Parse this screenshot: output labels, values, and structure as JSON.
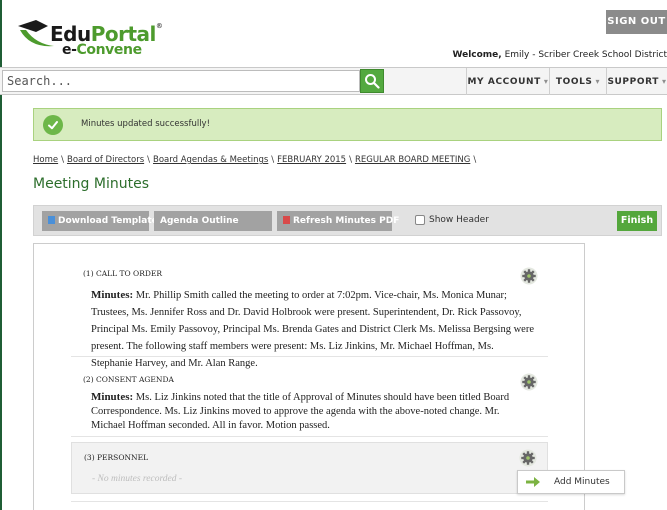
{
  "brand": {
    "name_part1": "Edu",
    "name_part2": "Portal",
    "tm": "®",
    "sub_part1": "e-",
    "sub_part2": "Convene"
  },
  "header": {
    "signout_label": "SIGN OUT",
    "welcome_prefix": "Welcome,",
    "welcome_user": "Emily - Scriber Creek School District"
  },
  "search": {
    "placeholder": "Search..."
  },
  "nav": {
    "items": [
      {
        "label": "MY ACCOUNT",
        "caret": "▾"
      },
      {
        "label": "TOOLS",
        "caret": "▾"
      },
      {
        "label": "SUPPORT",
        "caret": "▾"
      }
    ]
  },
  "alert": {
    "message": "Minutes updated successfully!"
  },
  "breadcrumb": {
    "items": [
      "Home",
      "Board of Directors",
      "Board Agendas & Meetings",
      "FEBRUARY 2015",
      "REGULAR BOARD MEETING"
    ],
    "separator": "\\"
  },
  "page": {
    "title": "Meeting Minutes"
  },
  "toolbar": {
    "download_label": "Download Template",
    "outline_label": "Agenda Outline",
    "refresh_label": "Refresh Minutes PDF",
    "show_header_label": "Show Header",
    "finish_label": "Finish"
  },
  "agenda": {
    "items": [
      {
        "title": "(1) CALL TO ORDER",
        "minutes_label": "Minutes:",
        "minutes_text": "Mr. Phillip Smith called the meeting to order at 7:02pm.  Vice-chair, Ms. Monica Munar; Trustees, Ms. Jennifer Ross and Dr. David Holbrook were present. Superintendent, Dr. Rick Passovoy, Principal Ms. Emily Passovoy, Principal Ms. Brenda Gates and District Clerk Ms. Melissa Bergsing were present.  The following staff members were present:  Ms. Liz Jinkins, Mr. Michael Hoffman, Ms. Stephanie Harvey, and Mr. Alan Range."
      },
      {
        "title": "(2) CONSENT AGENDA",
        "minutes_label": "Minutes:",
        "minutes_text": "Ms. Liz Jinkins noted that the title of Approval of Minutes should have been titled Board Correspondence. Ms. Liz Jinkins moved to approve the agenda with the above-noted change. Mr. Michael Hoffman seconded. All in favor. Motion passed."
      },
      {
        "title": "(3) PERSONNEL",
        "no_minutes_text": "- No minutes recorded -"
      }
    ]
  },
  "dropdown": {
    "add_minutes_label": "Add Minutes"
  },
  "colors": {
    "brand_green": "#4d9b2d",
    "title_green": "#2d6e2c",
    "finish_green": "#54a73c",
    "alert_bg": "#d7ecbf",
    "button_gray": "#a2a2a2"
  },
  "icons": [
    "search-icon",
    "check-icon",
    "doc-icon",
    "pdf-icon",
    "gear-icon",
    "arrow-right-icon",
    "caret-down-icon"
  ]
}
